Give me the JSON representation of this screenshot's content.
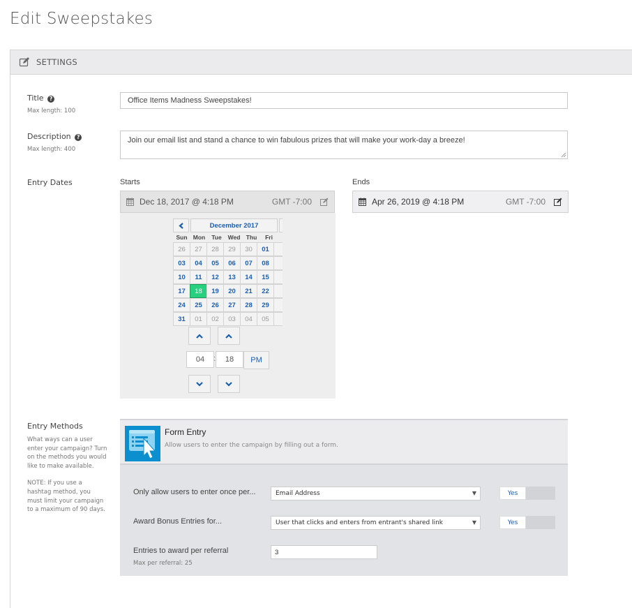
{
  "page": {
    "title": "Edit Sweepstakes"
  },
  "settings": {
    "header_label": "SETTINGS",
    "header_icon": "edit-icon",
    "title": {
      "label": "Title",
      "help_icon": "question-circle-icon",
      "hint": "Max length: 100",
      "value": "Office Items Madness Sweepstakes!"
    },
    "description": {
      "label": "Description",
      "help_icon": "question-circle-icon",
      "hint": "Max length: 400",
      "value": "Join our email list and stand a chance to win fabulous prizes that will make your work-day a breeze!"
    },
    "entry_dates": {
      "label": "Entry Dates",
      "starts": {
        "label": "Starts",
        "value": "Dec 18, 2017 @ 4:18 PM",
        "timezone": "GMT -7:00",
        "icon": "calendar-icon",
        "edit_icon": "edit-icon"
      },
      "ends": {
        "label": "Ends",
        "value": "Apr 26, 2019 @ 4:18 PM",
        "timezone": "GMT -7:00",
        "icon": "calendar-icon",
        "edit_icon": "edit-icon"
      },
      "picker": {
        "month_label": "December 2017",
        "prev_icon": "chevron-left-icon",
        "weekdays": [
          "Sun",
          "Mon",
          "Tue",
          "Wed",
          "Thu",
          "Fri"
        ],
        "weeks": [
          [
            {
              "d": "26",
              "o": true
            },
            {
              "d": "27",
              "o": true
            },
            {
              "d": "28",
              "o": true
            },
            {
              "d": "29",
              "o": true
            },
            {
              "d": "30",
              "o": true
            },
            {
              "d": "01"
            }
          ],
          [
            {
              "d": "03"
            },
            {
              "d": "04"
            },
            {
              "d": "05"
            },
            {
              "d": "06"
            },
            {
              "d": "07"
            },
            {
              "d": "08"
            }
          ],
          [
            {
              "d": "10"
            },
            {
              "d": "11"
            },
            {
              "d": "12"
            },
            {
              "d": "13"
            },
            {
              "d": "14"
            },
            {
              "d": "15"
            }
          ],
          [
            {
              "d": "17"
            },
            {
              "d": "18",
              "s": true
            },
            {
              "d": "19"
            },
            {
              "d": "20"
            },
            {
              "d": "21"
            },
            {
              "d": "22"
            }
          ],
          [
            {
              "d": "24"
            },
            {
              "d": "25"
            },
            {
              "d": "26"
            },
            {
              "d": "27"
            },
            {
              "d": "28"
            },
            {
              "d": "29"
            }
          ],
          [
            {
              "d": "31"
            },
            {
              "d": "01",
              "o": true
            },
            {
              "d": "02",
              "o": true
            },
            {
              "d": "03",
              "o": true
            },
            {
              "d": "04",
              "o": true
            },
            {
              "d": "05",
              "o": true
            }
          ]
        ],
        "selected_day": "18",
        "hour": "04",
        "minute": "18",
        "separator": ":",
        "meridiem": "PM"
      }
    },
    "entry_methods": {
      "label": "Entry Methods",
      "description": "What ways can a user enter your campaign? Turn on the methods you would like to make available.",
      "note": "NOTE: If you use a hashtag method, you must limit your campaign to a maximum of 90 days.",
      "form_entry": {
        "title": "Form Entry",
        "description": "Allow users to enter the campaign by filling out a form.",
        "icon": "form-entry-icon",
        "once_per": {
          "label": "Only allow users to enter once per...",
          "value": "Email Address",
          "toggle": "Yes"
        },
        "bonus": {
          "label": "Award Bonus Entries for...",
          "value": "User that clicks and enters from entrant's shared link",
          "toggle": "Yes"
        },
        "per_referral": {
          "label": "Entries to award per referral",
          "hint": "Max per referral: 25",
          "value": "3"
        }
      }
    }
  },
  "colors": {
    "accent": "#1a5fb4",
    "selected_day": "#27d07f",
    "method_icon_bg": "#0c8fcf"
  }
}
